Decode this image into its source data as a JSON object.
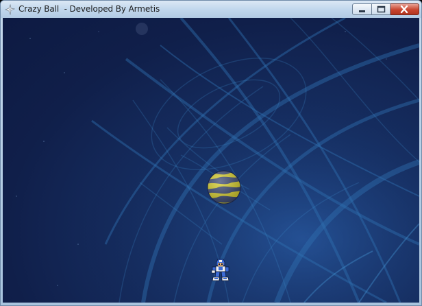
{
  "window": {
    "title": "Crazy Ball  - Developed By Armetis",
    "icon": "app-icon"
  },
  "controls": {
    "minimize": "minimize-icon",
    "maximize": "maximize-icon",
    "close": "close-icon"
  },
  "game": {
    "ball": {
      "colors": [
        "#d8cf2e",
        "#3d4a73"
      ]
    },
    "player": {
      "colors": [
        "#3c6bd6",
        "#f0f0f0",
        "#e8b070"
      ]
    },
    "background": {
      "accent": "#2e6fb0",
      "base": "#101f4a"
    }
  }
}
